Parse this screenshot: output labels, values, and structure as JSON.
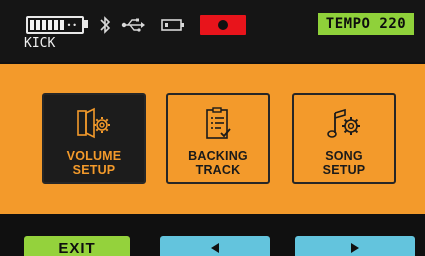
{
  "status_bar": {
    "kit_name": "KICK",
    "tempo_label": "TEMPO",
    "tempo_value": "220",
    "icons": [
      "battery-icon",
      "bluetooth-icon",
      "usb-icon",
      "sd-card-icon",
      "record-indicator-icon"
    ]
  },
  "menu": {
    "tiles": [
      {
        "line1": "VOLUME",
        "line2": "SETUP",
        "icon": "speaker-gear-icon",
        "selected": true
      },
      {
        "line1": "BACKING",
        "line2": "TRACK",
        "icon": "checklist-document-icon",
        "selected": false
      },
      {
        "line1": "SONG",
        "line2": "SETUP",
        "icon": "music-note-gear-icon",
        "selected": false
      }
    ]
  },
  "softkeys": {
    "exit_label": "EXIT",
    "prev_icon": "left-arrow-icon",
    "next_icon": "right-arrow-icon"
  },
  "colors": {
    "accent_orange": "#f39a2b",
    "tempo_green": "#8fd13a",
    "softkey_blue": "#63c4dd",
    "record_red": "#e8141b"
  }
}
